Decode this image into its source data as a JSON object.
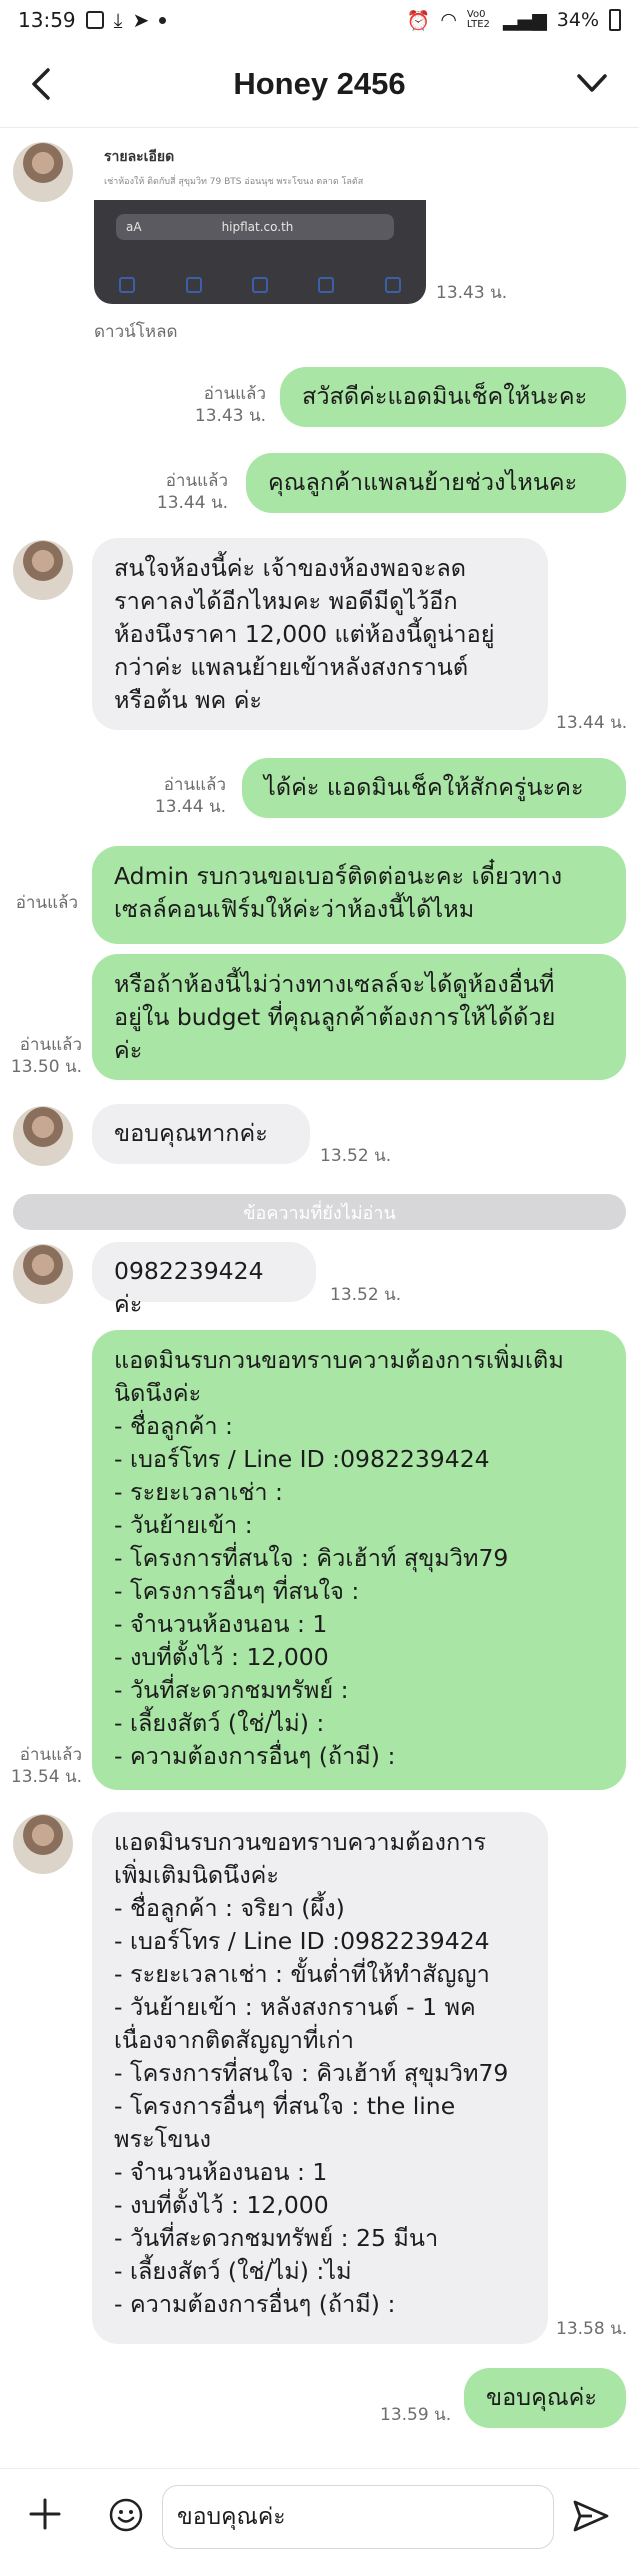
{
  "status_bar": {
    "time": "13:59",
    "network": "Vo0 LTE2",
    "battery": "34%"
  },
  "header": {
    "title": "Honey 2456"
  },
  "image_message": {
    "doc_title": "รายละเอียด",
    "doc_subtitle": "เช่าห้องให้ ติดกับสี่ สุขุมวิท 79 BTS อ่อนนุช พระโขนง ตลาด โลตัส",
    "url": "hipflat.co.th",
    "time": "13.43 น.",
    "download": "ดาวน์โหลด"
  },
  "messages": [
    {
      "side": "out",
      "text": "สวัสดีค่ะแอดมินเช็คให้นะคะ",
      "read": "อ่านแล้ว",
      "time": "13.43 น."
    },
    {
      "side": "out",
      "text": "คุณลูกค้าแพลนย้ายช่วงไหนคะ",
      "read": "อ่านแล้ว",
      "time": "13.44 น."
    },
    {
      "side": "in",
      "text": "สนใจห้องนี้ค่ะ เจ้าของห้องพอจะลด\nราคาลงได้อีกไหมคะ พอดีมีดูไว้อีก\nห้องนึงราคา 12,000 แต่ห้องนี้ดูน่าอยู่\nกว่าค่ะ แพลนย้ายเข้าหลังสงกรานต์\nหรือต้น พค ค่ะ",
      "time": "13.44 น."
    },
    {
      "side": "out",
      "text": "ได้ค่ะ แอดมินเช็คให้สักครู่นะคะ",
      "read": "อ่านแล้ว",
      "time": "13.44 น."
    },
    {
      "side": "out",
      "text": "Admin รบกวนขอเบอร์ติดต่อนะคะ เดี๋ยวทาง\nเซลล์คอนเฟิร์มให้ค่ะว่าห้องนี้ได้ไหม",
      "read": "อ่านแล้ว"
    },
    {
      "side": "out",
      "text": "หรือถ้าห้องนี้ไม่ว่างทางเซลล์จะได้ดูห้องอื่นที่\nอยู่ใน budget ที่คุณลูกค้าต้องการให้ได้ด้วย\nค่ะ",
      "read": "อ่านแล้ว",
      "time": "13.50 น."
    },
    {
      "side": "in",
      "text": "ขอบคุณทากค่ะ",
      "time": "13.52 น."
    },
    {
      "side": "in",
      "text": "0982239424 ค่ะ",
      "time": "13.52 น."
    },
    {
      "side": "out",
      "text": "แอดมินรบกวนขอทราบความต้องการเพิ่มเติม\nนิดนึงค่ะ\n- ชื่อลูกค้า :\n- เบอร์โทร / Line ID :0982239424\n- ระยะเวลาเช่า :\n- วันย้ายเข้า :\n- โครงการที่สนใจ : คิวเฮ้าท์ สุขุมวิท79\n- โครงการอื่นๆ ที่สนใจ :\n- จำนวนห้องนอน : 1\n- งบที่ตั้งไว้ : 12,000\n- วันที่สะดวกชมทรัพย์ :\n- เลี้ยงสัตว์ (ใช่/ไม่) :\n- ความต้องการอื่นๆ (ถ้ามี) :",
      "read": "อ่านแล้ว",
      "time": "13.54 น."
    },
    {
      "side": "in",
      "text": "แอดมินรบกวนขอทราบความต้องการ\nเพิ่มเติมนิดนึงค่ะ\n- ชื่อลูกค้า : จริยา (ผึ้ง)\n- เบอร์โทร / Line ID :0982239424\n- ระยะเวลาเช่า : ขั้นต่ำที่ให้ทำสัญญา\n- วันย้ายเข้า : หลังสงกรานต์ - 1 พค\nเนื่องจากติดสัญญาที่เก่า\n- โครงการที่สนใจ : คิวเฮ้าท์ สุขุมวิท79\n- โครงการอื่นๆ ที่สนใจ : the line\nพระโขนง\n- จำนวนห้องนอน : 1\n- งบที่ตั้งไว้ : 12,000\n- วันที่สะดวกชมทรัพย์ : 25 มีนา\n- เลี้ยงสัตว์ (ใช่/ไม่) :ไม่\n- ความต้องการอื่นๆ (ถ้ามี) :",
      "time": "13.58 น."
    },
    {
      "side": "out",
      "text": "ขอบคุณค่ะ",
      "time": "13.59 น."
    }
  ],
  "unread_divider": "ข้อความที่ยังไม่อ่าน",
  "input": {
    "value": "ขอบคุณค่ะ"
  },
  "icons": {
    "back": "back-arrow-icon",
    "menu": "chevron-down-icon",
    "plus": "plus-icon",
    "emoji": "emoji-icon",
    "send": "send-icon"
  },
  "colors": {
    "outgoing": "#a9e6a5",
    "incoming": "#efeff1",
    "divider": "#d7d7d9"
  }
}
